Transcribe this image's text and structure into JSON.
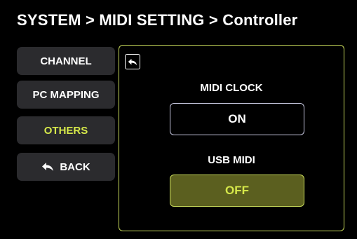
{
  "breadcrumb": "SYSTEM  >  MIDI SETTING > Controller",
  "nav": {
    "channel": "CHANNEL",
    "pc_mapping": "PC MAPPING",
    "others": "OTHERS",
    "back": "BACK"
  },
  "panel": {
    "midi_clock_label": "MIDI CLOCK",
    "midi_clock_value": "ON",
    "usb_midi_label": "USB MIDI",
    "usb_midi_value": "OFF"
  },
  "colors": {
    "accent": "#d6e84a",
    "panel_border": "#c6d85a",
    "button_bg": "#2b2b2e",
    "off_fill": "#5b5f1f"
  },
  "icons": {
    "back": "reply-arrow-icon",
    "panel_back": "reply-arrow-icon"
  }
}
